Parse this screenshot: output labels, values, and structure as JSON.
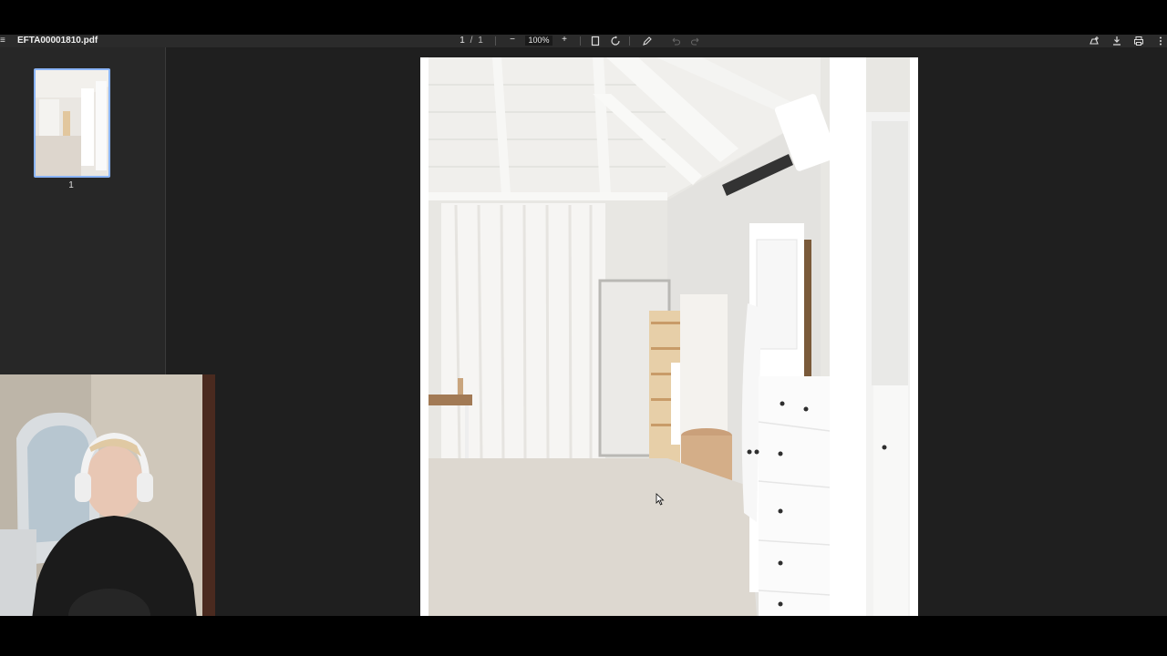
{
  "app": {
    "file_name": "EFTA00001810.pdf"
  },
  "toolbar": {
    "current_page": "1",
    "page_separator": "/",
    "total_pages": "1",
    "zoom_out_label": "−",
    "zoom_value": "100%",
    "zoom_in_label": "+",
    "icons": [
      "menu-icon",
      "fit-page-icon",
      "rotate-icon",
      "annotate-icon",
      "undo-icon",
      "redo-icon",
      "add-to-drive-icon",
      "download-icon",
      "print-icon",
      "more-icon"
    ]
  },
  "sidebar": {
    "thumbnails": [
      {
        "label": "1",
        "selected": true
      }
    ]
  },
  "colors": {
    "toolbar_bg": "#2b2b2b",
    "viewer_bg": "#1f1f1f",
    "sidebar_bg": "#272727",
    "thumb_selected": "#8ab4f8"
  }
}
